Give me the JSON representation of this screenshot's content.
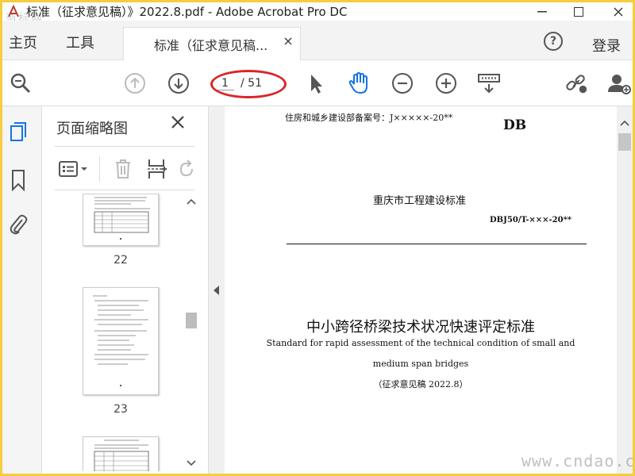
{
  "window": {
    "title": "标准（征求意见稿）》2022.8.pdf - Adobe Acrobat Pro DC",
    "watermark_top": "道标网",
    "watermark_bottom": "www.cndao.com"
  },
  "menu": {
    "home": "主页",
    "tools": "工具",
    "document_tab": "标准（征求意见稿...",
    "login": "登录"
  },
  "toolbar": {
    "current_page": "1",
    "total_pages": "/ 51"
  },
  "thumbnails": {
    "title": "页面缩略图",
    "pages": [
      {
        "label": "22"
      },
      {
        "label": "23"
      }
    ]
  },
  "document": {
    "filing_number": "住房和城乡建设部备案号：J×××××-20**",
    "db_code": "DB",
    "issuer": "重庆市工程建设标准",
    "standard_number": "DBJ50/T-×××-20**",
    "title_cn": "中小跨径桥梁技术状况快速评定标准",
    "title_en_line1": "Standard for rapid assessment of the technical condition of small and",
    "title_en_line2": "medium span bridges",
    "draft_note": "（征求意见稿 2022.8）"
  },
  "colors": {
    "frame": "#f5cd3f",
    "highlight": "#d9262b",
    "acrobat_red": "#c0392b",
    "selected_tool": "#1473e6"
  },
  "icons": [
    "zoom-search-icon",
    "page-up-icon",
    "page-down-icon",
    "select-cursor-icon",
    "hand-tool-icon",
    "zoom-out-icon",
    "zoom-in-icon",
    "scan-ruler-icon",
    "share-link-icon",
    "add-user-icon",
    "thumbnails-icon",
    "bookmark-icon",
    "attachment-icon",
    "options-menu-icon",
    "trash-icon",
    "insert-page-icon",
    "rotate-icon"
  ]
}
